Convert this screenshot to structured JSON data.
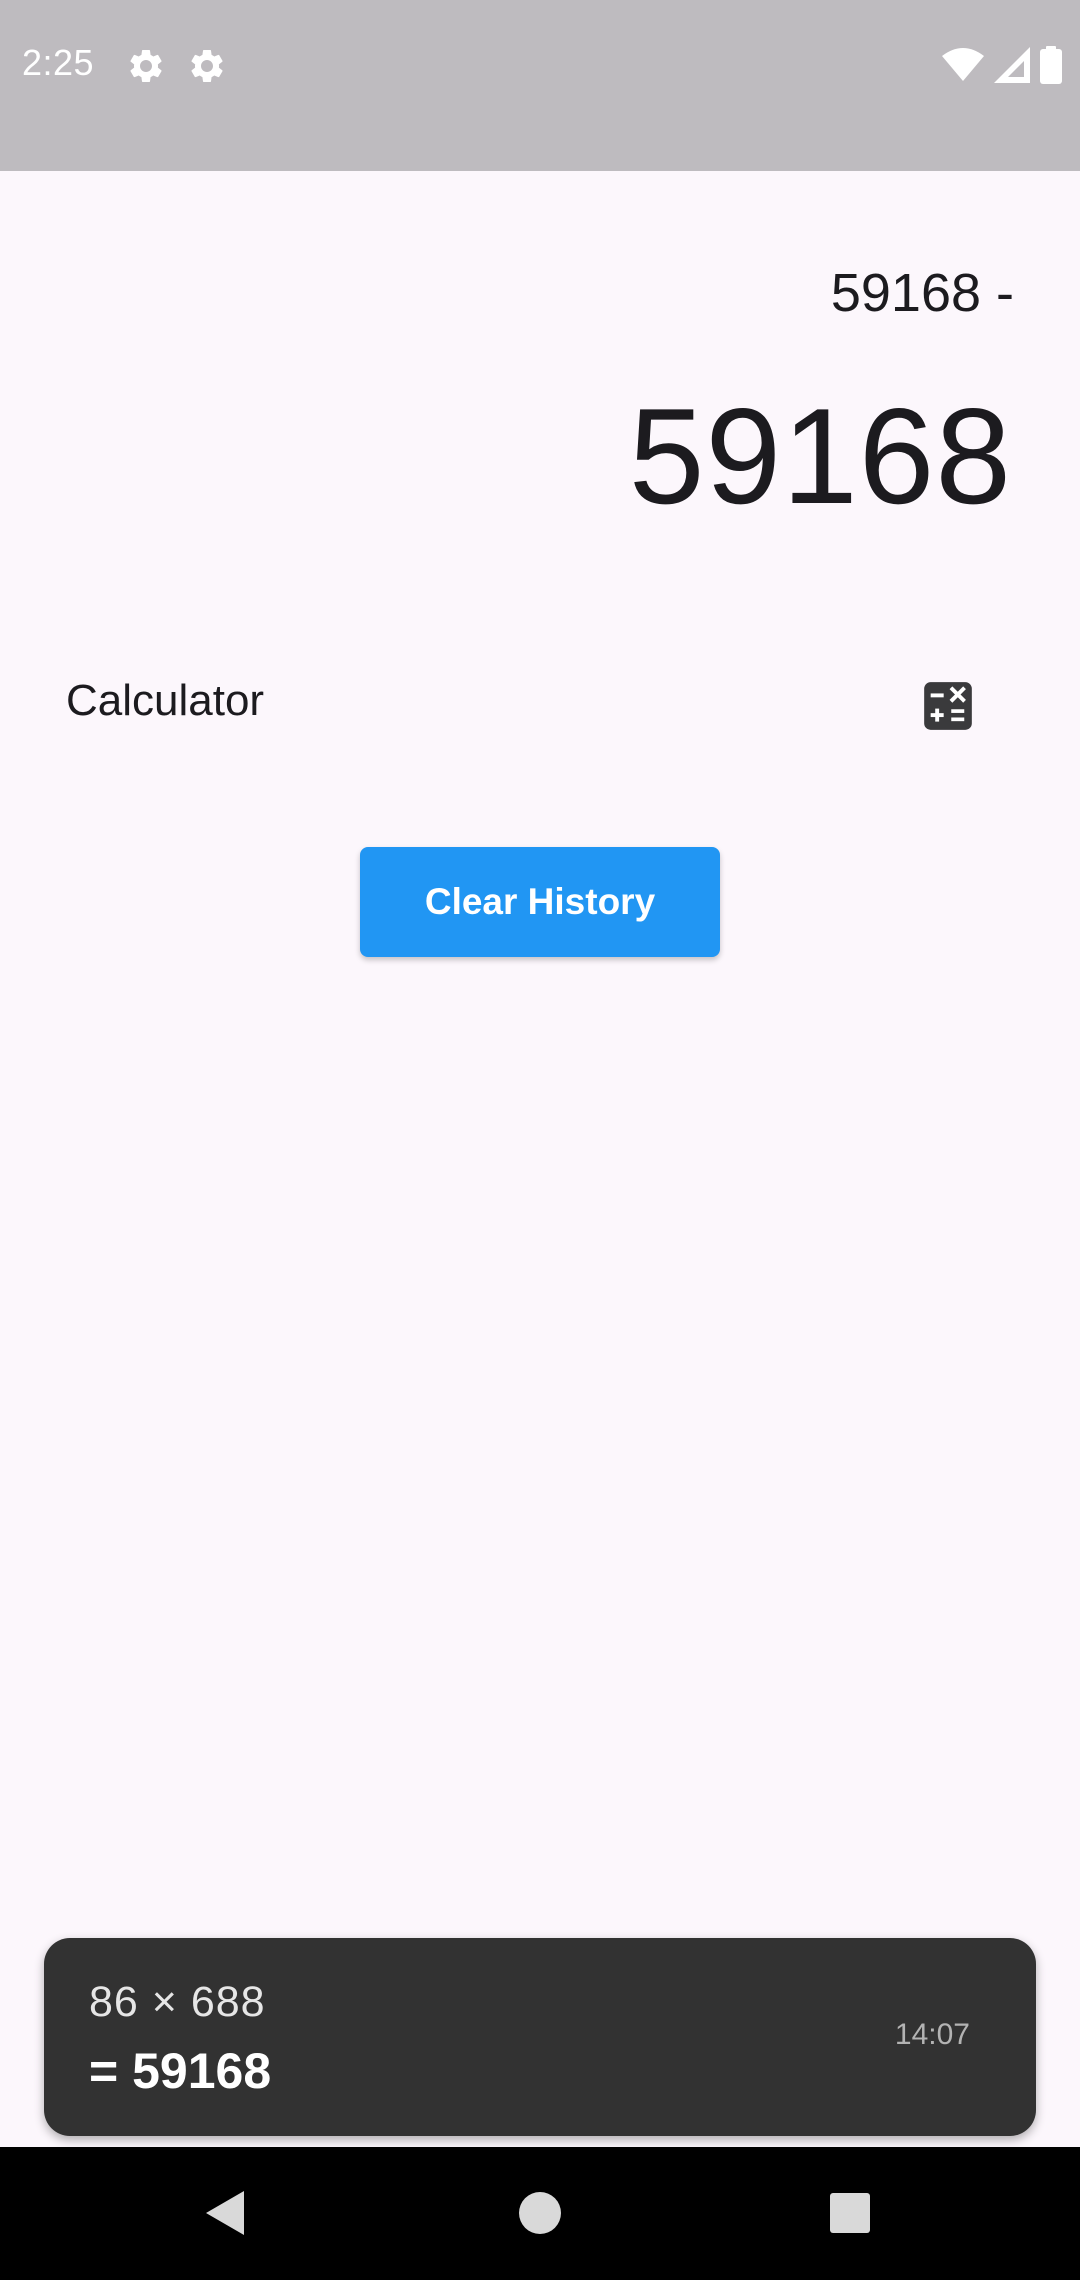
{
  "status_bar": {
    "time": "2:25",
    "icons": [
      "gear-icon",
      "gear-icon",
      "wifi-icon",
      "signal-icon",
      "battery-icon"
    ]
  },
  "display": {
    "expression": "59168 -",
    "result": "59168"
  },
  "calculator_row": {
    "label": "Calculator",
    "icon": "calculator-icon"
  },
  "clear_button": {
    "label": "Clear History",
    "color": "#2196F3"
  },
  "history": {
    "expression": "86 × 688",
    "result": "= 59168",
    "time": "14:07"
  },
  "nav_bar": {
    "icons": [
      "back-icon",
      "home-icon",
      "recents-icon"
    ]
  },
  "colors": {
    "background": "#FCF7FC",
    "status_bar": "#BEBBBF",
    "snackbar": "#323232",
    "nav_bar": "#000000"
  }
}
